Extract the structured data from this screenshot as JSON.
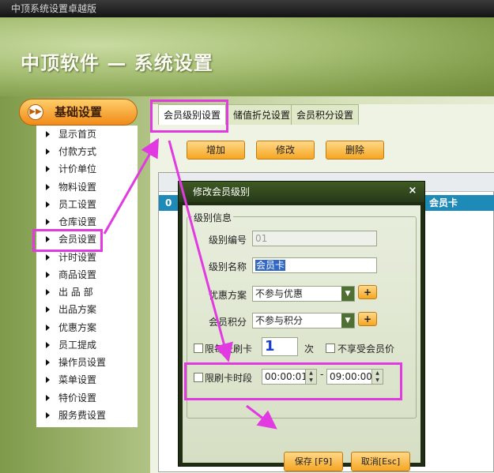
{
  "window": {
    "title": "中顶系统设置卓越版"
  },
  "header": {
    "title": "中顶软件 — 系统设置"
  },
  "nav": {
    "header": "基础设置",
    "items": [
      "显示首页",
      "付款方式",
      "计价单位",
      "物料设置",
      "员工设置",
      "仓库设置",
      "会员设置",
      "计时设置",
      "商品设置",
      "出 品 部",
      "出品方案",
      "优惠方案",
      "员工提成",
      "操作员设置",
      "菜单设置",
      "特价设置",
      "服务费设置"
    ]
  },
  "tabs": [
    "会员级别设置",
    "储值折兑设置",
    "会员积分设置"
  ],
  "toolbar": {
    "add": "增加",
    "edit": "修改",
    "delete": "删除"
  },
  "grid": {
    "selected_cell": "会员卡",
    "row_marker": "0"
  },
  "dialog": {
    "title": "修改会员级别",
    "close": "×",
    "group": "级别信息",
    "level_no_label": "级别编号",
    "level_no_value": "01",
    "level_name_label": "级别名称",
    "level_name_value": "会员卡",
    "discount_label": "优惠方案",
    "discount_value": "不参与优惠",
    "points_label": "会员积分",
    "points_value": "不参与积分",
    "plus": "+",
    "daily_limit_label": "限每天刷卡",
    "daily_limit_value": "1",
    "daily_limit_unit": "次",
    "no_member_price_label": "不享受会员价",
    "time_limit_label": "限刷卡时段",
    "time_from": "00:00:01",
    "time_sep": "-",
    "time_to": "09:00:00",
    "save": "保存 [F9]",
    "cancel": "取消[Esc]"
  },
  "colors": {
    "highlight": "#e13ae0",
    "accent": "#f5a623",
    "selection": "#1e8ab8"
  }
}
